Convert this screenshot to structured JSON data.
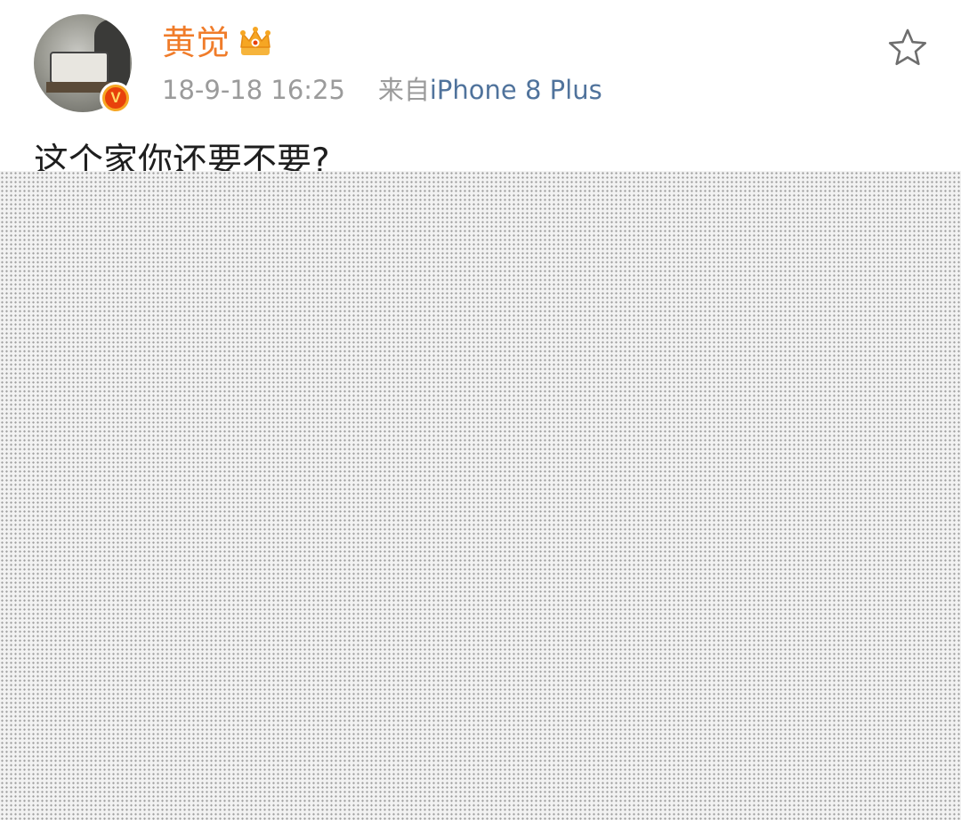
{
  "post": {
    "author": {
      "name": "黄觉",
      "avatar_icon": "avatar-photo",
      "verified_icon": "verified-v-badge-icon",
      "verified_letter": "V",
      "member_icon": "crown-icon"
    },
    "meta": {
      "timestamp": "18-9-18 16:25",
      "source_prefix": "来自",
      "source_app": "iPhone 8 Plus"
    },
    "text": "这个家你还要不要?",
    "favorite_icon": "star-outline-icon",
    "image": {
      "style": "gray-dotted-pattern"
    }
  },
  "colors": {
    "username": "#f07c2a",
    "meta_text": "#9b9b9b",
    "source_link": "#50739c",
    "body_text": "#1e1e1e",
    "verified_badge": "#f6a623",
    "image_background": "#f2f2f2"
  }
}
